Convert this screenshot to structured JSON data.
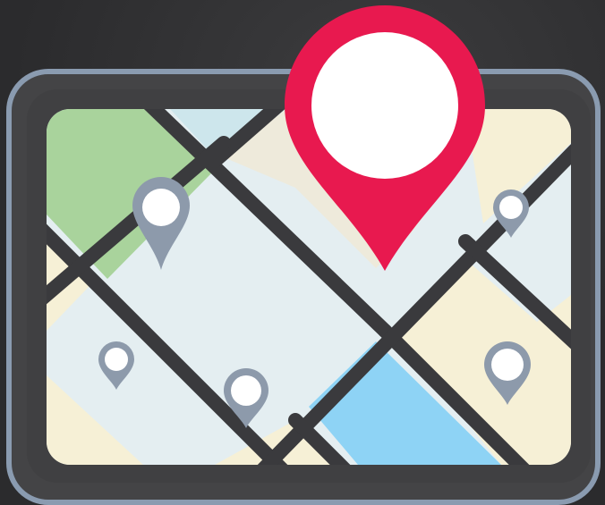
{
  "icon": {
    "name": "map-location-icon",
    "colors": {
      "background": "#2d2d2f",
      "background_glow": "#3a3a3c",
      "frame_outline": "#8a9bb0",
      "frame_body": "#474749",
      "road": "#3a3a3d",
      "block_green": "#a9d39c",
      "block_cream": "#f6f0d6",
      "block_light_blue": "#e4eef1",
      "block_pale_cyan": "#cde6ec",
      "block_beige": "#eeeadb",
      "block_water": "#8ed3f5",
      "primary_pin": "#e8194f",
      "secondary_pin": "#8d9aab",
      "pin_center": "#ffffff"
    }
  }
}
